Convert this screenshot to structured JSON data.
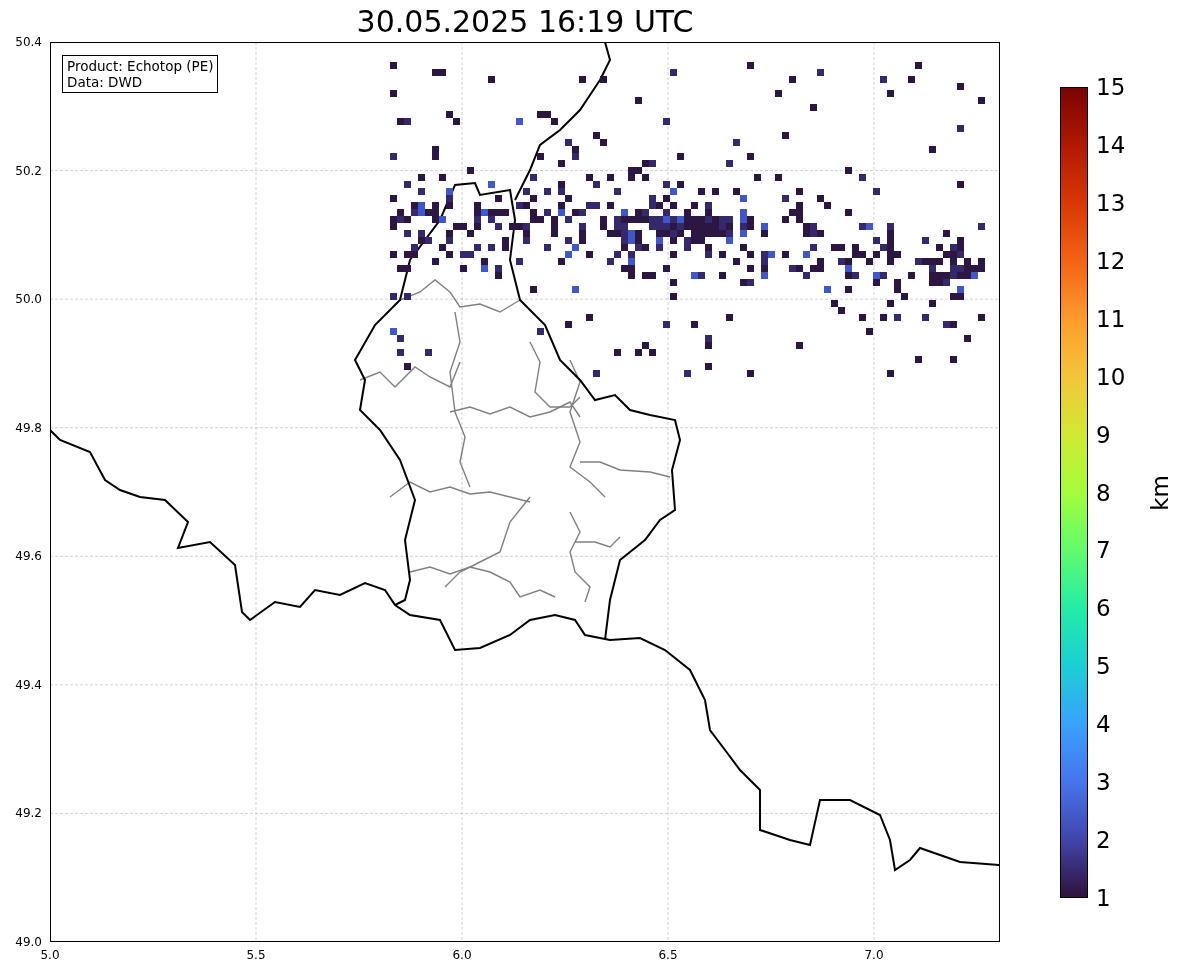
{
  "title": "30.05.2025 16:19 UTC",
  "annotation": {
    "lines": [
      "Product: Echotop (PE)",
      "Data: DWD"
    ]
  },
  "map": {
    "xticks": [
      "5.0",
      "5.5",
      "6.0",
      "6.5",
      "7.0"
    ],
    "yticks": [
      "50.4",
      "50.2",
      "50.0",
      "49.8",
      "49.6",
      "49.4",
      "49.2",
      "49.0"
    ]
  },
  "colorbar": {
    "label": "km",
    "ticks": [
      "15",
      "14",
      "13",
      "12",
      "11",
      "10",
      "9",
      "8",
      "7",
      "6",
      "5",
      "4",
      "3",
      "2",
      "1"
    ]
  }
}
